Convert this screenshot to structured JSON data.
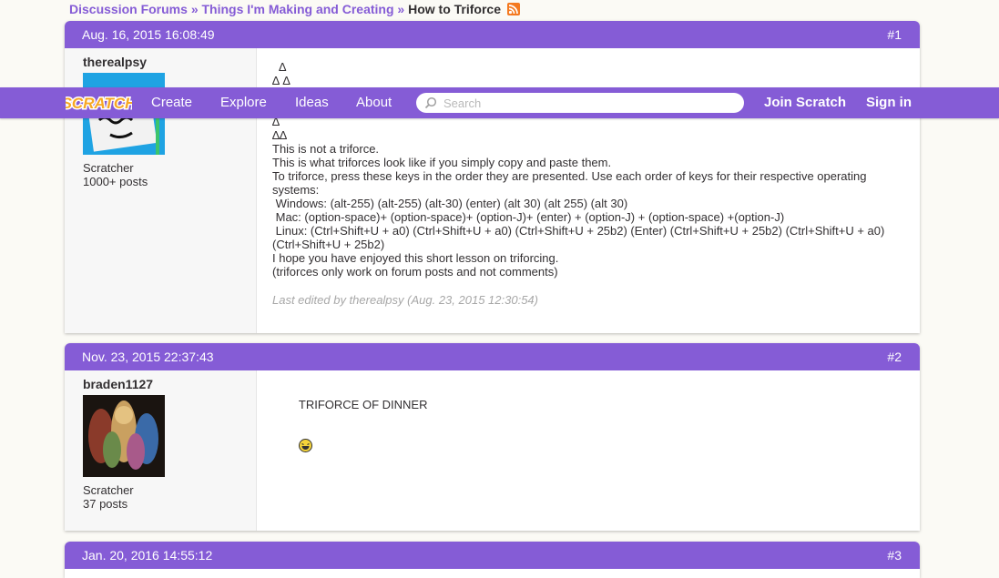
{
  "breadcrumb": {
    "items": [
      "Discussion Forums",
      "Things I'm Making and Creating"
    ],
    "separator": "»",
    "current": "How to Triforce"
  },
  "navbar": {
    "logo_text": "SCRATCH",
    "links": [
      "Create",
      "Explore",
      "Ideas",
      "About"
    ],
    "search_placeholder": "Search",
    "join": "Join Scratch",
    "signin": "Sign in"
  },
  "posts": [
    {
      "date": "Aug. 16, 2015 16:08:49",
      "number": "#1",
      "username": "therealpsy",
      "role": "Scratcher",
      "post_count": "1000+ posts",
      "lines": [
        "  ∆",
        "∆ ∆",
        "∆",
        "∆∆",
        "This is not a triforce.",
        "This is what triforces look like if you simply copy and paste them.",
        "To triforce, press these keys in the order they are presented. Use each order of keys for their respective operating systems:",
        " Windows: (alt-255) (alt-255) (alt-30) (enter) (alt 30) (alt 255) (alt 30)",
        " Mac: (option-space)+ (option-space)+ (option-J)+ (enter) + (option-J) + (option-space) +(option-J)",
        " Linux: (Ctrl+Shift+U + a0) (Ctrl+Shift+U + a0) (Ctrl+Shift+U + 25b2) (Enter) (Ctrl+Shift+U + 25b2) (Ctrl+Shift+U + a0) (Ctrl+Shift+U + 25b2)",
        "I hope you have enjoyed this short lesson on triforcing.",
        "(triforces only work on forum posts and not comments)"
      ],
      "edited": "Last edited by therealpsy (Aug. 23, 2015 12:30:54)"
    },
    {
      "date": "Nov. 23, 2015 22:37:43",
      "number": "#2",
      "username": "braden1127",
      "role": "Scratcher",
      "post_count": "37 posts",
      "text": "TRIFORCE OF DINNER"
    },
    {
      "date": "Jan. 20, 2016 14:55:12",
      "number": "#3"
    }
  ],
  "colors": {
    "accent": "#855cd6",
    "background": "#fbfaf5",
    "rss": "#f47920"
  }
}
